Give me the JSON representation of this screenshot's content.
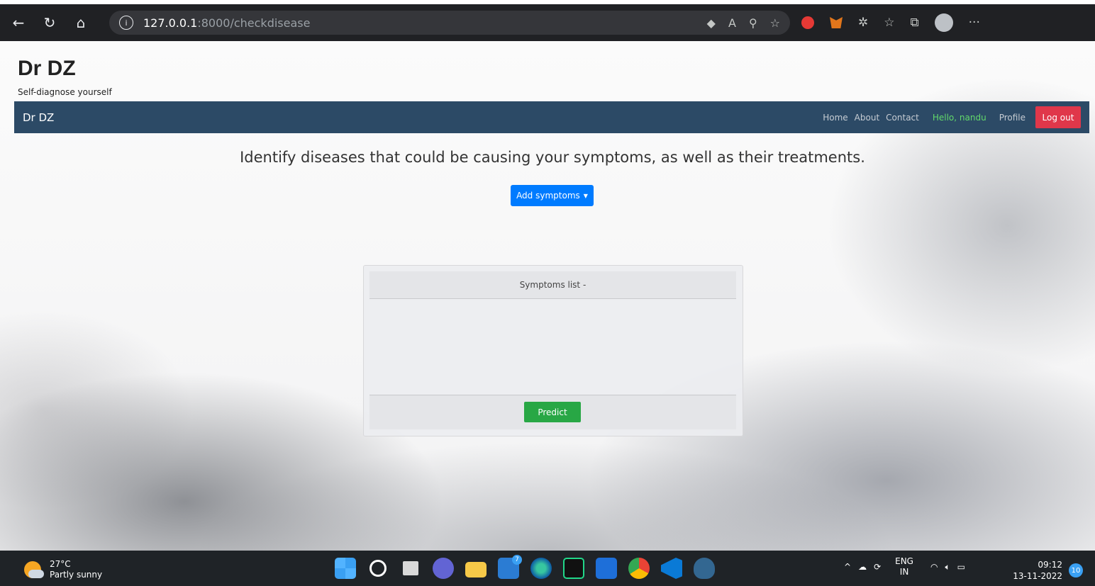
{
  "browser": {
    "url_host": "127.0.0.1",
    "url_rest": ":8000/checkdisease"
  },
  "site": {
    "brand": "Dr DZ",
    "tagline": "Self-diagnose yourself"
  },
  "navbar": {
    "brand": "Dr DZ",
    "links": [
      "Home",
      "About",
      "Contact"
    ],
    "greeting": "Hello, nandu",
    "profile": "Profile",
    "logout": "Log out"
  },
  "main": {
    "heading": "Identify diseases that could be causing your symptoms, as well as their treatments.",
    "add_symptoms": "Add symptoms",
    "symptoms_list_label": "Symptoms list -",
    "predict": "Predict"
  },
  "taskbar": {
    "temperature": "27°C",
    "weather": "Partly sunny",
    "mail_badge": "7",
    "lang_top": "ENG",
    "lang_bottom": "IN",
    "time": "09:12",
    "date": "13-11-2022",
    "notifications": "10"
  },
  "colors": {
    "navbar": "#2c4a66",
    "primary_button": "#007bff",
    "success_button": "#28a745",
    "logout_button": "#e0374a",
    "greeting": "#62d96b"
  }
}
